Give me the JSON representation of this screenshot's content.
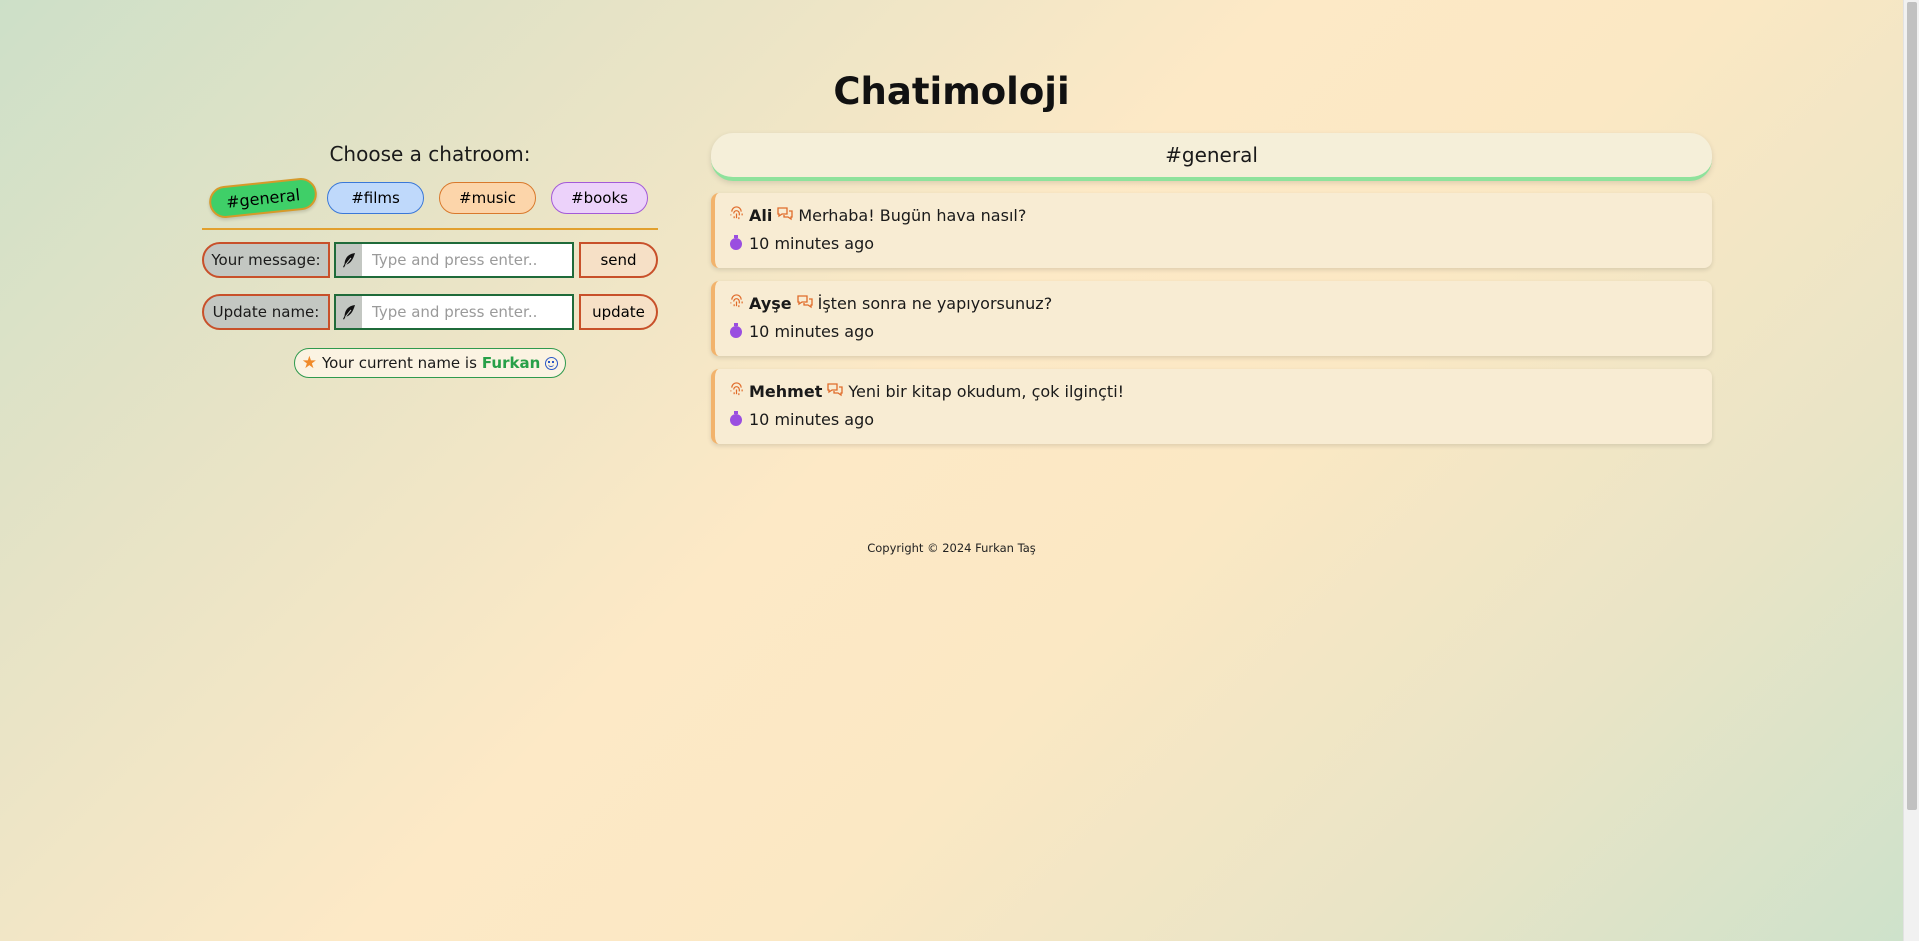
{
  "app": {
    "title": "Chatimoloji"
  },
  "rooms": {
    "heading": "Choose a chatroom:",
    "items": [
      {
        "label": "#general",
        "active": true,
        "color": "#3fcf68"
      },
      {
        "label": "#films",
        "active": false,
        "color": "#bfd9fb"
      },
      {
        "label": "#music",
        "active": false,
        "color": "#fcd5aa"
      },
      {
        "label": "#books",
        "active": false,
        "color": "#ecd2fa"
      }
    ]
  },
  "message_form": {
    "label": "Your message:",
    "icon": "feather-icon",
    "placeholder": "Type and press enter..",
    "value": "",
    "button": "send"
  },
  "name_form": {
    "label": "Update name:",
    "icon": "feather-icon",
    "placeholder": "Type and press enter..",
    "value": "",
    "button": "update"
  },
  "current_name": {
    "prefix": "Your current name is",
    "name": "Furkan",
    "icon_left": "star-icon",
    "icon_right": "smile-icon"
  },
  "chat": {
    "room_title": "#general",
    "messages": [
      {
        "author": "Ali",
        "text": "Merhaba! Bugün hava nasıl?",
        "time": "10 minutes ago"
      },
      {
        "author": "Ayşe",
        "text": "İşten sonra ne yapıyorsunuz?",
        "time": "10 minutes ago"
      },
      {
        "author": "Mehmet",
        "text": "Yeni bir kitap okudum, çok ilginçti!",
        "time": "10 minutes ago"
      }
    ]
  },
  "footer": {
    "text": "Copyright © 2024 Furkan Taş"
  },
  "colors": {
    "accent_orange": "#e06b2a",
    "accent_green": "#27a048",
    "timer_purple": "#9a4ee0",
    "divider": "#e2a02e"
  }
}
